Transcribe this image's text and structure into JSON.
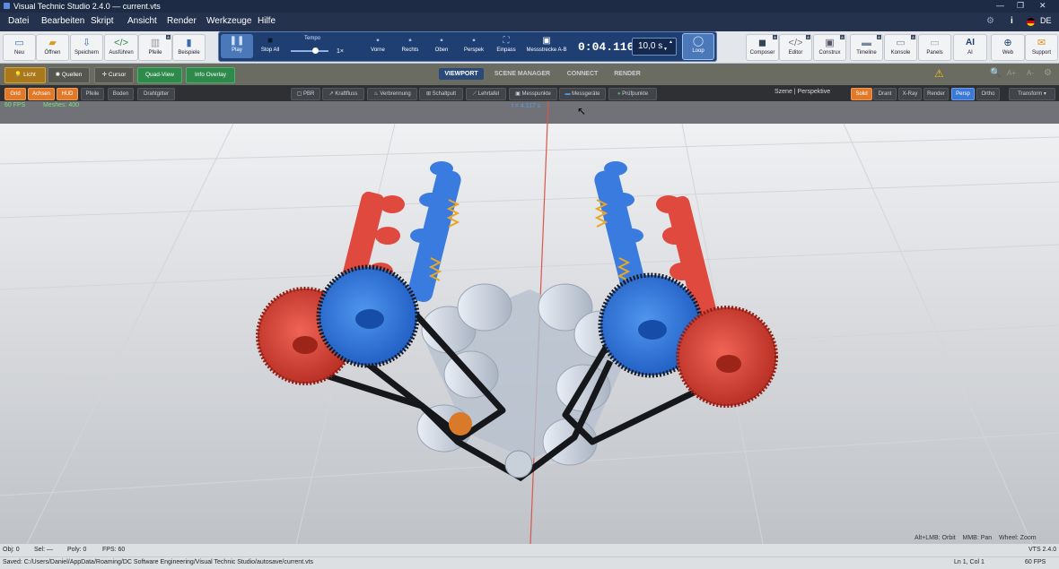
{
  "window": {
    "title": "Visual Technic Studio 2.4.0 — current.vts"
  },
  "menu": {
    "items": [
      "Datei",
      "Bearbeiten",
      "Skript",
      "Ansicht",
      "Render",
      "Werkzeuge",
      "Hilfe"
    ],
    "lang": "DE"
  },
  "toolbar": {
    "file": [
      "Neu",
      "Öffnen",
      "Speichern",
      "Ausführen",
      "Pfeile",
      "Beispiele"
    ],
    "play": "Play",
    "stop_all": "Stop All",
    "tempo": "Tempo",
    "tempo_value": "1×",
    "views": [
      "Vorne",
      "Rechts",
      "Oben",
      "Perspek",
      "Einpass",
      "Messstrecke A-B"
    ],
    "time": "0:04.116",
    "duration": "10,0 s",
    "loop": "Loop",
    "tools": [
      "Composer",
      "Editor",
      "Construx",
      "Timeline",
      "Konsole",
      "Panels",
      "AI",
      "Web",
      "Support"
    ]
  },
  "secondary": {
    "licht": "Licht",
    "quellen": "Quellen",
    "cursor": "Cursor",
    "quad_view": "Quad-View",
    "info_overlay": "Info Overlay",
    "tabs": [
      "VIEWPORT",
      "SCENE MANAGER",
      "CONNECT",
      "RENDER"
    ]
  },
  "display": {
    "toggles": [
      "Grid",
      "Achsen",
      "HUD",
      "Pfeile",
      "Boden",
      "Drahtgitter"
    ],
    "tools": [
      "PBR",
      "Kraftfluss",
      "Verbrennung",
      "Schaltpult",
      "Lehrtafel",
      "Messpunkte",
      "Messgeräte",
      "Prüfpunkte"
    ],
    "scene_label": "Szene | Perspektive",
    "modes": [
      "Solid",
      "Drant",
      "X-Ray",
      "Render"
    ],
    "proj": [
      "Persp",
      "Ortho"
    ],
    "transform": "Transform ▾"
  },
  "hud": {
    "fps": "60 FPS",
    "meshes": "Meshes: 400",
    "time_marker": "t = 4.117 s"
  },
  "viewport": {
    "nav_hint": "Alt+LMB: Orbit    MMB: Pan    Wheel: Zoom"
  },
  "status": {
    "obj": "Obj: 0",
    "sel": "Sel: —",
    "poly": "Poly: 0",
    "fps": "FPS: 60",
    "version": "VTS 2.4.0"
  },
  "path": {
    "saved": "Saved: C:/Users/Daniel/AppData/Roaming/DC Software Engineering/Visual Technic Studio/autosave/current.vts",
    "cursor": "Ln 1, Col 1",
    "fps": "60 FPS"
  },
  "colors": {
    "accent_orange": "#e07a2a",
    "green": "#2f8a4c",
    "blue": "#3b78d8",
    "red_gear": "#e0493e"
  }
}
